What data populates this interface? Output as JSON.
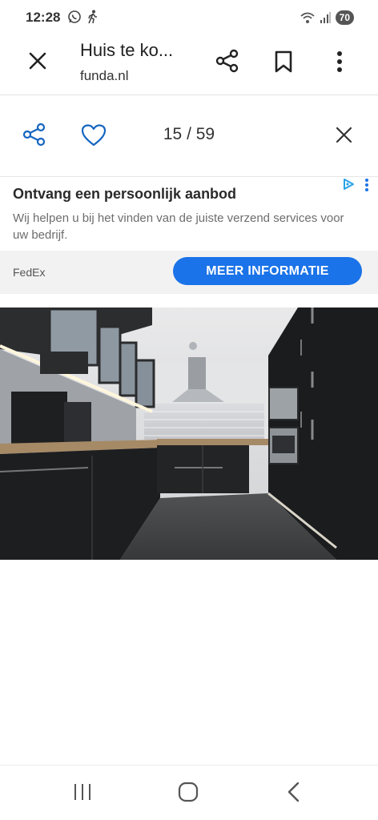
{
  "status_bar": {
    "time": "12:28",
    "battery": "70",
    "icons_left": [
      "whatsapp-icon",
      "walking-icon"
    ],
    "icons_right": [
      "wifi-icon",
      "signal-icon",
      "battery-icon"
    ]
  },
  "top_bar": {
    "title": "Huis te ko...",
    "subtitle": "funda.nl",
    "icons": [
      "close-icon",
      "share-icon",
      "bookmark-icon",
      "more-icon"
    ]
  },
  "gallery_bar": {
    "counter": "15 / 59",
    "icons": [
      "share-icon",
      "heart-icon",
      "close-icon"
    ]
  },
  "ad": {
    "title": "Ontvang een persoonlijk aanbod",
    "body": "Wij helpen u bij het vinden van de juiste verzend services voor uw bedrijf.",
    "advertiser": "FedEx",
    "cta": "MEER INFORMATIE",
    "accent_color": "#1a73e8"
  },
  "photo": {
    "subject": "kitchen"
  },
  "nav_bar": {
    "icons": [
      "recent-apps-icon",
      "home-icon",
      "back-icon"
    ]
  }
}
